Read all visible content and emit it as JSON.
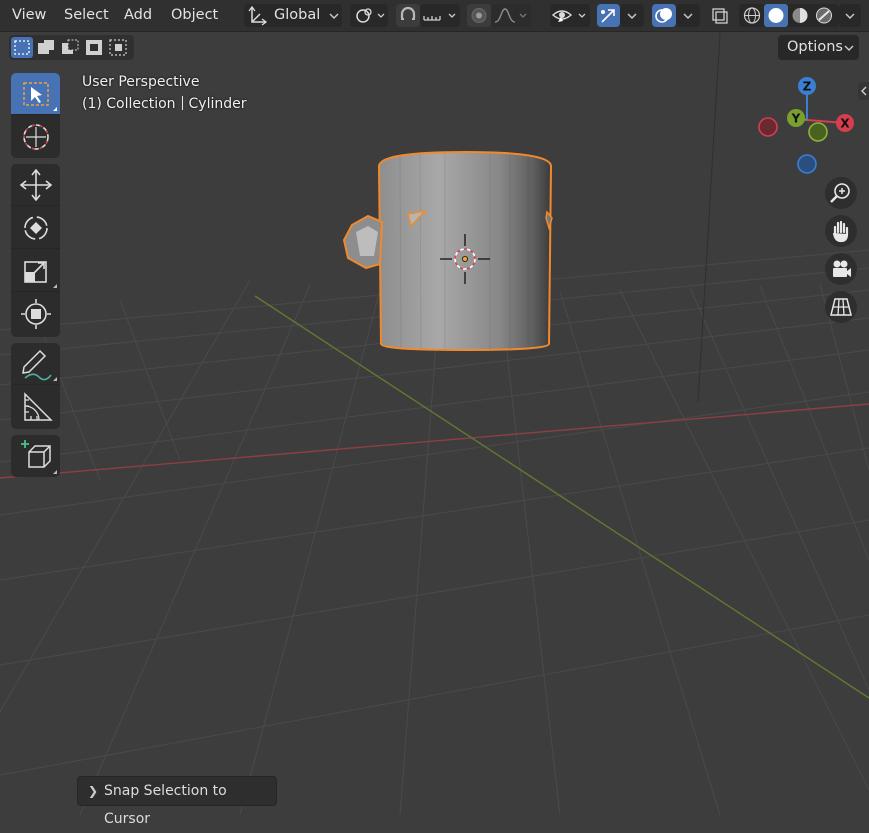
{
  "menu": {
    "view": "View",
    "select": "Select",
    "add": "Add",
    "object": "Object"
  },
  "header": {
    "transform_orientation": "Global",
    "options_label": "Options"
  },
  "viewport": {
    "view_name": "User Perspective",
    "collection_label": "(1) Collection",
    "object_name": "Cylinder"
  },
  "gizmo": {
    "x_label": "X",
    "y_label": "Y",
    "z_label": "Z"
  },
  "last_operator": {
    "label": "Snap Selection to Cursor"
  },
  "colors": {
    "accent": "#4772b3",
    "selection_outline": "#f08a2c",
    "x_axis": "#d63d4f",
    "y_axis": "#79a02f",
    "z_axis": "#3a7fd3",
    "viewport_bg": "#3d3d3d"
  },
  "icons": {
    "orientation": "transform-orientation-icon",
    "pivot": "pivot-point-icon",
    "snap": "snap-magnet-icon",
    "snap_target": "snap-increment-icon",
    "proportional": "proportional-editing-icon",
    "falloff": "falloff-curve-icon",
    "visibility": "visibility-eye-icon",
    "gizmos": "gizmos-toggle-icon",
    "overlays": "overlays-toggle-icon",
    "xray": "xray-toggle-icon",
    "shading": [
      "wireframe-shading-icon",
      "solid-shading-icon",
      "material-preview-icon",
      "rendered-shading-icon"
    ],
    "nav": [
      "zoom-icon",
      "pan-hand-icon",
      "camera-icon",
      "grid-ortho-icon"
    ]
  }
}
